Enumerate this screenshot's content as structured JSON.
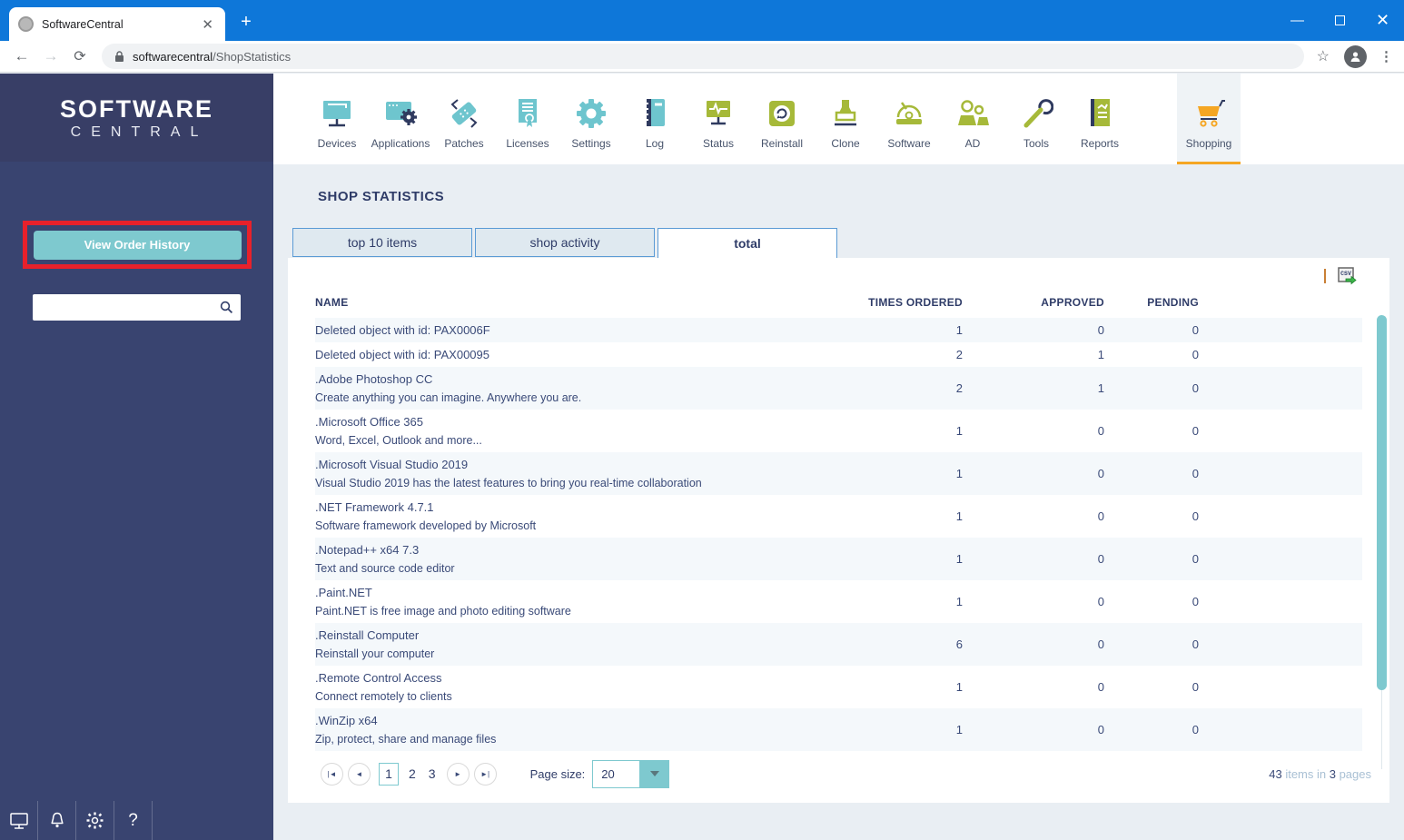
{
  "browser": {
    "tab_title": "SoftwareCentral",
    "url_host": "softwarecentral",
    "url_path": "/ShopStatistics"
  },
  "sidebar": {
    "logo_line1": "SOFTWARE",
    "logo_line2": "CENTRAL",
    "view_order_history_label": "View Order History",
    "search_placeholder": ""
  },
  "nav": {
    "active": "Shopping",
    "items": [
      {
        "label": "Devices"
      },
      {
        "label": "Applications"
      },
      {
        "label": "Patches"
      },
      {
        "label": "Licenses"
      },
      {
        "label": "Settings"
      },
      {
        "label": "Log"
      },
      {
        "label": "Status"
      },
      {
        "label": "Reinstall"
      },
      {
        "label": "Clone"
      },
      {
        "label": "Software"
      },
      {
        "label": "AD"
      },
      {
        "label": "Tools"
      },
      {
        "label": "Reports"
      },
      {
        "label": "Shopping"
      }
    ]
  },
  "main": {
    "title": "SHOP STATISTICS",
    "tabs": [
      {
        "label": "top 10 items",
        "active": false
      },
      {
        "label": "shop activity",
        "active": false
      },
      {
        "label": "total",
        "active": true
      }
    ],
    "table": {
      "headers": {
        "name": "NAME",
        "times_ordered": "TIMES ORDERED",
        "approved": "APPROVED",
        "pending": "PENDING"
      },
      "rows": [
        {
          "name": "Deleted object with id: PAX0006F",
          "description": "",
          "times_ordered": "1",
          "approved": "0",
          "pending": "0"
        },
        {
          "name": "Deleted object with id: PAX00095",
          "description": "",
          "times_ordered": "2",
          "approved": "1",
          "pending": "0"
        },
        {
          "name": ".Adobe Photoshop CC",
          "description": "Create anything you can imagine. Anywhere you are.",
          "times_ordered": "2",
          "approved": "1",
          "pending": "0"
        },
        {
          "name": ".Microsoft Office 365",
          "description": "Word, Excel, Outlook and more...",
          "times_ordered": "1",
          "approved": "0",
          "pending": "0"
        },
        {
          "name": ".Microsoft Visual Studio 2019",
          "description": "Visual Studio 2019 has the latest features to bring you real-time collaboration",
          "times_ordered": "1",
          "approved": "0",
          "pending": "0"
        },
        {
          "name": ".NET Framework 4.7.1",
          "description": "Software framework developed by Microsoft",
          "times_ordered": "1",
          "approved": "0",
          "pending": "0"
        },
        {
          "name": ".Notepad++ x64 7.3",
          "description": "Text and source code editor",
          "times_ordered": "1",
          "approved": "0",
          "pending": "0"
        },
        {
          "name": ".Paint.NET",
          "description": "Paint.NET is free image and photo editing software",
          "times_ordered": "1",
          "approved": "0",
          "pending": "0"
        },
        {
          "name": ".Reinstall Computer",
          "description": "Reinstall your computer",
          "times_ordered": "6",
          "approved": "0",
          "pending": "0"
        },
        {
          "name": ".Remote Control Access",
          "description": "Connect remotely to clients",
          "times_ordered": "1",
          "approved": "0",
          "pending": "0"
        },
        {
          "name": ".WinZip x64",
          "description": "Zip, protect, share and manage files",
          "times_ordered": "1",
          "approved": "0",
          "pending": "0"
        }
      ]
    },
    "pagination": {
      "pages": [
        "1",
        "2",
        "3"
      ],
      "current_page": "1",
      "page_size_label": "Page size:",
      "page_size_value": "20",
      "summary_count": "43",
      "summary_mid": " items in ",
      "summary_pages": "3",
      "summary_end": " pages"
    }
  },
  "colors": {
    "chrome_blue": "#0E77D9",
    "sidebar_navy": "#394470",
    "sidebar_header_navy": "#383E66",
    "accent_teal": "#7EC9CF",
    "icon_teal": "#6EC5CE",
    "icon_olive": "#A6B939",
    "icon_orange": "#F5A623",
    "text_navy": "#2F3C68",
    "tab_border_blue": "#5B9BD5",
    "annotation_red": "#E8212B",
    "active_tab_underline": "#F5A623"
  }
}
